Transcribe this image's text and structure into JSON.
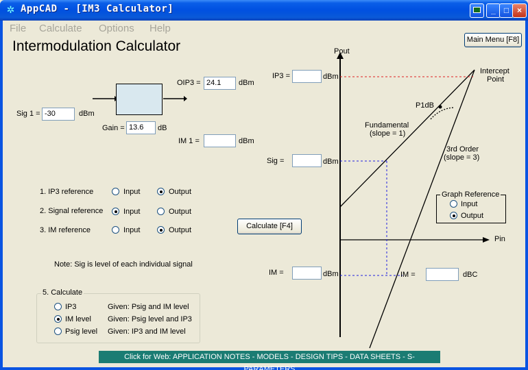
{
  "window": {
    "title": "AppCAD - [IM3 Calculator]",
    "minimize_label": "_",
    "maximize_label": "□",
    "close_label": "×"
  },
  "menu": [
    "File",
    "Calculate",
    "Options",
    "Help"
  ],
  "page_title": "Intermodulation Calculator",
  "main_menu_button": "Main Menu [F8]",
  "inputs": {
    "sig1_label": "Sig 1 =",
    "sig1_value": "-30",
    "sig1_unit": "dBm",
    "oip3_label": "OIP3 =",
    "oip3_value": "24.1",
    "oip3_unit": "dBm",
    "gain_label": "Gain =",
    "gain_value": "13.6",
    "gain_unit": "dB",
    "im1_label": "IM 1 =",
    "im1_value": "",
    "im1_unit": "dBm"
  },
  "references": [
    {
      "label": "1. IP3 reference",
      "selected": "Output"
    },
    {
      "label": "2. Signal reference",
      "selected": "Input"
    },
    {
      "label": "3. IM reference",
      "selected": "Output"
    }
  ],
  "ref_options": {
    "input": "Input",
    "output": "Output"
  },
  "calculate_button": "Calculate  [F4]",
  "note": "Note: Sig is level of each individual signal",
  "calc_group": {
    "title": "5. Calculate",
    "options": [
      {
        "label": "IP3",
        "given": "Given:  Psig and IM level",
        "selected": false
      },
      {
        "label": "IM level",
        "given": "Given:  Psig level and IP3",
        "selected": true
      },
      {
        "label": "Psig level",
        "given": "Given:  IP3 and IM level",
        "selected": false
      }
    ]
  },
  "graph": {
    "y_axis_label": "Pout",
    "x_axis_label": "Pin",
    "ip3_label": "IP3 =",
    "ip3_unit": "dBm",
    "ip3_value": "",
    "sig_label": "Sig =",
    "sig_unit": "dBm",
    "sig_value": "",
    "im_label": "IM =",
    "im_unit": "dBm",
    "im_value": "",
    "imc_label": "IM =",
    "imc_unit": "dBC",
    "imc_value": "",
    "intercept_label_1": "Intercept",
    "intercept_label_2": "Point",
    "p1db_label": "P1dB",
    "fundamental_label_1": "Fundamental",
    "fundamental_label_2": "(slope = 1)",
    "third_order_label_1": "3rd Order",
    "third_order_label_2": "(slope = 3)"
  },
  "graph_reference": {
    "title": "Graph Reference",
    "input_label": "Input",
    "output_label": "Output",
    "selected": "Output"
  },
  "web_link": "Click for Web: APPLICATION NOTES - MODELS - DESIGN TIPS - DATA SHEETS - S-PARAMETERS"
}
